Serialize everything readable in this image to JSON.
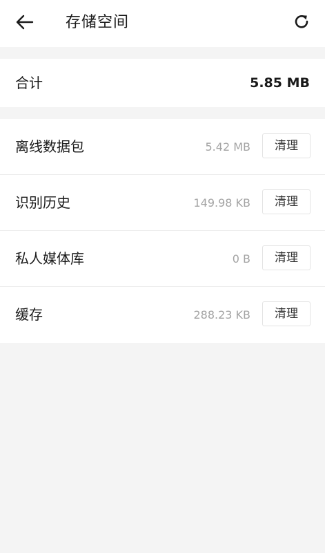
{
  "header": {
    "title": "存储空间",
    "back_icon": "arrow-left-icon",
    "refresh_icon": "refresh-icon"
  },
  "summary": {
    "label": "合计",
    "value": "5.85 MB"
  },
  "items": [
    {
      "label": "离线数据包",
      "size": "5.42 MB",
      "button": "清理"
    },
    {
      "label": "识别历史",
      "size": "149.98 KB",
      "button": "清理"
    },
    {
      "label": "私人媒体库",
      "size": "0 B",
      "button": "清理"
    },
    {
      "label": "缓存",
      "size": "288.23 KB",
      "button": "清理"
    }
  ]
}
